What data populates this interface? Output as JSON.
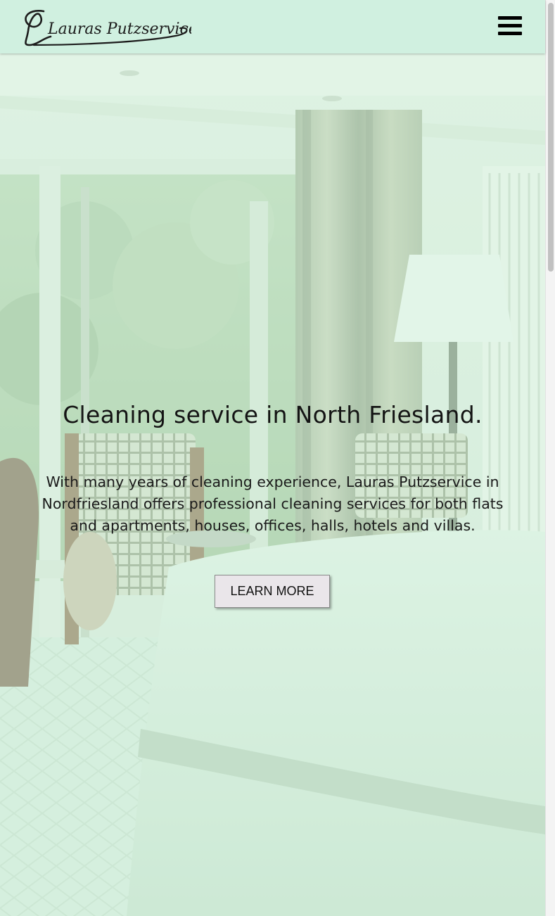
{
  "header": {
    "logo_text": "Lauras Putzservice",
    "menu_icon": "hamburger-menu-icon"
  },
  "hero": {
    "title": "Cleaning service in North Friesland.",
    "description": "With many years of cleaning experience, Lauras Putzservice in Nordfriesland offers professional cleaning services for both flats and apartments, houses, offices, halls, hotels and villas.",
    "button_label": "LEARN MORE",
    "background_image": "hotel-room-photo"
  },
  "colors": {
    "header_background": "#d0f0e0",
    "overlay_tint": "#d2f5e1",
    "button_background": "#eae6ea",
    "text": "#141414"
  }
}
